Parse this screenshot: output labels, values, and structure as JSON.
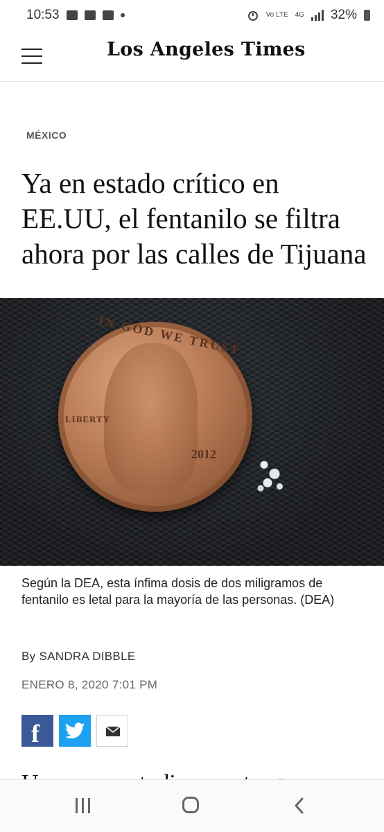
{
  "status_bar": {
    "time": "10:53",
    "volte": "Vo LTE",
    "network": "4G",
    "battery": "32%",
    "icons": [
      "gallery-icon",
      "facebook-notification-icon",
      "facebook-notification-icon",
      "notification-dot-icon",
      "alarm-icon",
      "signal-icon",
      "battery-icon"
    ]
  },
  "header": {
    "logo": "Los Angeles Times",
    "menu_icon": "hamburger-menu-icon"
  },
  "article": {
    "section": "MÉXICO",
    "headline": "Ya en estado crítico en EE.UU, el fentanilo se filtra ahora por las calles de Tijuana",
    "image": {
      "coin_motto": "IN GOD WE TRUST",
      "coin_liberty": "LIBERTY",
      "coin_year": "2012"
    },
    "caption": "Según la DEA, esta ínfima dosis de dos miligramos de fentanilo es letal para la mayoría de las personas. (DEA)",
    "byline": "By SANDRA DIBBLE",
    "date": "ENERO 8, 2020 7:01 PM",
    "body_preview": "Un nuevo estudio muestra que"
  },
  "share": {
    "facebook_glyph": "f",
    "icons": [
      "facebook-icon",
      "twitter-icon",
      "email-icon"
    ],
    "colors": {
      "facebook": "#3b5998",
      "twitter": "#1da1f2"
    }
  },
  "nav_bar": {
    "icons": [
      "recent-apps-icon",
      "home-icon",
      "back-icon"
    ]
  }
}
